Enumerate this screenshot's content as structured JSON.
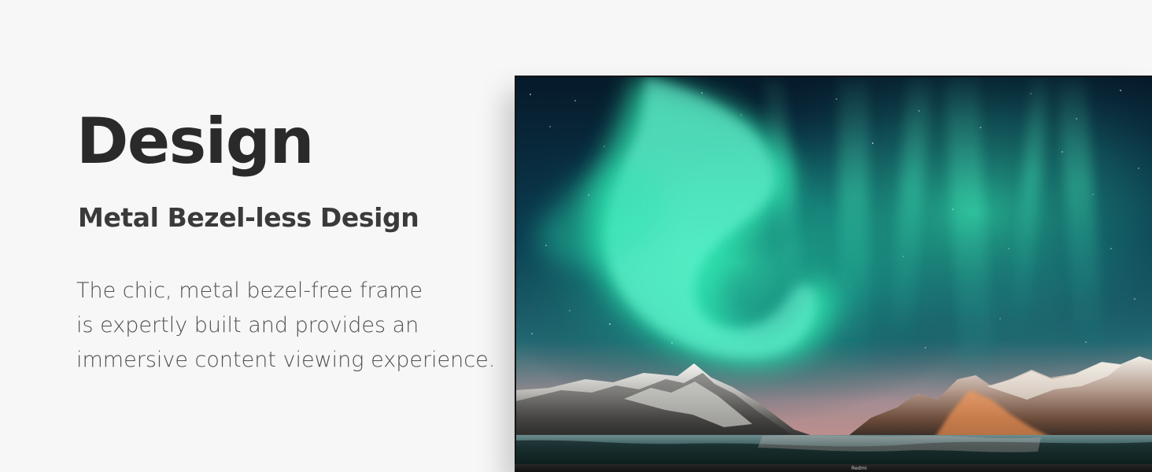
{
  "content": {
    "headline": "Design",
    "subheadline": "Metal Bezel-less Design",
    "description_lines": [
      "The chic, metal bezel-free frame",
      "is expertly built and provides an",
      "immersive content viewing experience."
    ]
  },
  "tv": {
    "brand_label": "Redmi",
    "screen_image": "aurora-over-snowy-mountains"
  },
  "colors": {
    "background": "#f7f7f7",
    "headline": "#2a2a2a",
    "body_text": "#505050",
    "aurora": "#31e9b1",
    "sky": "#05111d"
  }
}
